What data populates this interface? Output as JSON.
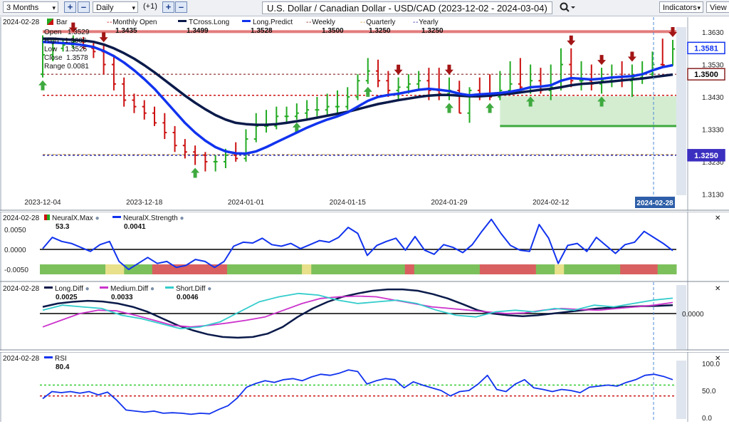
{
  "toolbar": {
    "period": "3 Months",
    "interval": "Daily",
    "offset": "(+1)",
    "title": "U.S. Dollar / Canadian Dollar - USD/CAD (2023-12-02 - 2024-03-04)",
    "indicators_label": "Indicators",
    "view_label": "View"
  },
  "main": {
    "date_label": "2024-02-28",
    "ohlc": {
      "open_label": "Open",
      "open": "1.3529",
      "high_label": "High",
      "high": "1.3606",
      "low_label": "Low",
      "low": "1.3526",
      "close_label": "Close",
      "close": "1.3578",
      "range_label": "Range",
      "range": "0.0081"
    },
    "legend": [
      {
        "label": "Bar",
        "value": ""
      },
      {
        "label": "Monthly Open",
        "value": "1.3435"
      },
      {
        "label": "TCross.Long",
        "value": "1.3499"
      },
      {
        "label": "Long.Predict",
        "value": "1.3528"
      },
      {
        "label": "Weekly",
        "value": "1.3500"
      },
      {
        "label": "Quarterly",
        "value": "1.3250"
      },
      {
        "label": "Yearly",
        "value": "1.3250"
      }
    ],
    "y_ticks": [
      "1.3630",
      "1.3530",
      "1.3430",
      "1.3330",
      "1.3230",
      "1.3130"
    ],
    "price_tags": [
      "1.3581",
      "1.3500",
      "1.3250"
    ],
    "x_ticks": [
      "2023-12-04",
      "2023-12-18",
      "2024-01-01",
      "2024-01-15",
      "2024-01-29",
      "2024-02-12",
      "2024-"
    ],
    "cursor_date": "2024-02-28"
  },
  "panel2": {
    "date_label": "2024-02-28",
    "legend": [
      {
        "label": "NeuralX.Max",
        "value": "53.3"
      },
      {
        "label": "NeuralX.Strength",
        "value": "0.0041"
      }
    ],
    "y_ticks": [
      "0.0050",
      "0.0000",
      "-0.0050"
    ]
  },
  "panel3": {
    "date_label": "2024-02-28",
    "legend": [
      {
        "label": "Long.Diff",
        "value": "0.0025"
      },
      {
        "label": "Medium.Diff",
        "value": "0.0033"
      },
      {
        "label": "Short.Diff",
        "value": "0.0046"
      }
    ],
    "y_ticks": [
      "0.0000"
    ]
  },
  "panel4": {
    "date_label": "2024-02-28",
    "legend": [
      {
        "label": "RSI",
        "value": "80.4"
      }
    ],
    "y_ticks": [
      "100.0",
      "50.0",
      "0.0"
    ]
  },
  "colors": {
    "up": "#22aa22",
    "down": "#cc1111",
    "long_predict": "#1133ee",
    "tcross": "#0a1a4a",
    "monthly": "#cc1111",
    "weekly": "#882222",
    "quarterly": "#d4a24a",
    "yearly": "#2a2aa8",
    "rsi": "#1133ee",
    "medium_diff": "#cc33cc",
    "short_diff": "#33cccc"
  },
  "chart_data": [
    {
      "type": "bar",
      "title": "U.S. Dollar / Canadian Dollar - USD/CAD",
      "ylim": [
        1.31,
        1.365
      ],
      "x": [
        "2023-12-04",
        "2023-12-05",
        "2023-12-06",
        "2023-12-07",
        "2023-12-08",
        "2023-12-11",
        "2023-12-12",
        "2023-12-13",
        "2023-12-14",
        "2023-12-15",
        "2023-12-18",
        "2023-12-19",
        "2023-12-20",
        "2023-12-21",
        "2023-12-22",
        "2023-12-25",
        "2023-12-26",
        "2023-12-27",
        "2023-12-28",
        "2023-12-29",
        "2024-01-01",
        "2024-01-02",
        "2024-01-03",
        "2024-01-04",
        "2024-01-05",
        "2024-01-08",
        "2024-01-09",
        "2024-01-10",
        "2024-01-11",
        "2024-01-12",
        "2024-01-15",
        "2024-01-16",
        "2024-01-17",
        "2024-01-18",
        "2024-01-19",
        "2024-01-22",
        "2024-01-23",
        "2024-01-24",
        "2024-01-25",
        "2024-01-26",
        "2024-01-29",
        "2024-01-30",
        "2024-01-31",
        "2024-02-01",
        "2024-02-02",
        "2024-02-05",
        "2024-02-06",
        "2024-02-07",
        "2024-02-08",
        "2024-02-09",
        "2024-02-12",
        "2024-02-13",
        "2024-02-14",
        "2024-02-15",
        "2024-02-16",
        "2024-02-19",
        "2024-02-20",
        "2024-02-21",
        "2024-02-22",
        "2024-02-23",
        "2024-02-26",
        "2024-02-27",
        "2024-02-28"
      ],
      "open": [
        1.35,
        1.356,
        1.358,
        1.359,
        1.36,
        1.358,
        1.357,
        1.353,
        1.347,
        1.342,
        1.34,
        1.338,
        1.335,
        1.332,
        1.328,
        1.326,
        1.325,
        1.323,
        1.323,
        1.325,
        1.324,
        1.33,
        1.334,
        1.334,
        1.337,
        1.337,
        1.338,
        1.339,
        1.339,
        1.34,
        1.34,
        1.343,
        1.348,
        1.351,
        1.348,
        1.345,
        1.346,
        1.347,
        1.348,
        1.345,
        1.344,
        1.345,
        1.338,
        1.345,
        1.344,
        1.343,
        1.345,
        1.347,
        1.346,
        1.348,
        1.345,
        1.346,
        1.353,
        1.348,
        1.348,
        1.347,
        1.348,
        1.349,
        1.348,
        1.349,
        1.35,
        1.353,
        1.3529
      ],
      "high": [
        1.362,
        1.3605,
        1.361,
        1.362,
        1.3615,
        1.36,
        1.359,
        1.356,
        1.349,
        1.344,
        1.342,
        1.34,
        1.338,
        1.334,
        1.33,
        1.328,
        1.326,
        1.325,
        1.327,
        1.329,
        1.333,
        1.338,
        1.339,
        1.34,
        1.34,
        1.341,
        1.342,
        1.343,
        1.344,
        1.345,
        1.346,
        1.35,
        1.355,
        1.3545,
        1.351,
        1.349,
        1.35,
        1.351,
        1.352,
        1.352,
        1.349,
        1.348,
        1.346,
        1.349,
        1.35,
        1.351,
        1.354,
        1.355,
        1.353,
        1.352,
        1.353,
        1.358,
        1.358,
        1.354,
        1.353,
        1.352,
        1.353,
        1.354,
        1.353,
        1.354,
        1.357,
        1.361,
        1.3606
      ],
      "low": [
        1.349,
        1.354,
        1.357,
        1.358,
        1.358,
        1.355,
        1.35,
        1.345,
        1.34,
        1.338,
        1.336,
        1.334,
        1.33,
        1.326,
        1.324,
        1.322,
        1.32,
        1.32,
        1.321,
        1.323,
        1.323,
        1.329,
        1.332,
        1.333,
        1.335,
        1.336,
        1.336,
        1.337,
        1.337,
        1.338,
        1.339,
        1.342,
        1.347,
        1.346,
        1.343,
        1.342,
        1.344,
        1.345,
        1.342,
        1.342,
        1.342,
        1.338,
        1.335,
        1.342,
        1.342,
        1.342,
        1.344,
        1.345,
        1.344,
        1.344,
        1.342,
        1.345,
        1.346,
        1.345,
        1.345,
        1.344,
        1.346,
        1.346,
        1.343,
        1.347,
        1.349,
        1.352,
        1.3526
      ],
      "close": [
        1.356,
        1.358,
        1.359,
        1.36,
        1.358,
        1.357,
        1.353,
        1.347,
        1.342,
        1.34,
        1.338,
        1.335,
        1.332,
        1.328,
        1.326,
        1.325,
        1.323,
        1.323,
        1.325,
        1.324,
        1.33,
        1.334,
        1.334,
        1.337,
        1.337,
        1.338,
        1.339,
        1.339,
        1.34,
        1.34,
        1.343,
        1.348,
        1.351,
        1.348,
        1.345,
        1.346,
        1.347,
        1.348,
        1.345,
        1.344,
        1.345,
        1.338,
        1.345,
        1.344,
        1.343,
        1.345,
        1.347,
        1.346,
        1.348,
        1.345,
        1.346,
        1.353,
        1.348,
        1.348,
        1.347,
        1.348,
        1.349,
        1.348,
        1.349,
        1.35,
        1.353,
        1.3529,
        1.3578
      ],
      "series": [
        {
          "name": "Long.Predict",
          "values": [
            1.36,
            1.3598,
            1.3596,
            1.3594,
            1.359,
            1.3584,
            1.3572,
            1.3556,
            1.3536,
            1.3512,
            1.3485,
            1.3455,
            1.342,
            1.3385,
            1.335,
            1.332,
            1.3295,
            1.3275,
            1.3262,
            1.3256,
            1.3255,
            1.3262,
            1.3275,
            1.329,
            1.3305,
            1.332,
            1.3335,
            1.3348,
            1.336,
            1.337,
            1.3382,
            1.34,
            1.3418,
            1.343,
            1.3436,
            1.344,
            1.3446,
            1.3452,
            1.3455,
            1.3452,
            1.3448,
            1.344,
            1.3435,
            1.3438,
            1.344,
            1.3442,
            1.3446,
            1.3452,
            1.346,
            1.3462,
            1.3466,
            1.348,
            1.3488,
            1.3486,
            1.3484,
            1.3486,
            1.349,
            1.3492,
            1.3494,
            1.35,
            1.3512,
            1.3522,
            1.3528
          ]
        },
        {
          "name": "TCross.Long",
          "values": [
            1.361,
            1.361,
            1.3608,
            1.3606,
            1.3604,
            1.36,
            1.3592,
            1.358,
            1.3565,
            1.3548,
            1.3528,
            1.3506,
            1.3482,
            1.3458,
            1.3434,
            1.3412,
            1.3392,
            1.3374,
            1.336,
            1.335,
            1.3346,
            1.3344,
            1.3344,
            1.3346,
            1.335,
            1.3355,
            1.336,
            1.3366,
            1.3372,
            1.3378,
            1.3384,
            1.3392,
            1.34,
            1.3408,
            1.3414,
            1.342,
            1.3425,
            1.343,
            1.3434,
            1.3436,
            1.3436,
            1.3434,
            1.3432,
            1.3432,
            1.3434,
            1.3437,
            1.344,
            1.3444,
            1.3448,
            1.3452,
            1.3455,
            1.346,
            1.3466,
            1.347,
            1.3472,
            1.3475,
            1.3478,
            1.3481,
            1.3484,
            1.3487,
            1.3491,
            1.3495,
            1.3499
          ]
        }
      ],
      "levels": [
        {
          "name": "Monthly Open",
          "value": 1.3435
        },
        {
          "name": "Weekly",
          "value": 1.35
        },
        {
          "name": "Quarterly",
          "value": 1.325
        },
        {
          "name": "Yearly",
          "value": 1.325
        }
      ]
    },
    {
      "type": "line",
      "title": "NeuralX.Strength",
      "ylim": [
        -0.008,
        0.008
      ],
      "series": [
        {
          "name": "NeuralX.Strength",
          "values": [
            0.0002,
            0.003,
            0.002,
            0.0015,
            0.0005,
            -0.0005,
            0.0012,
            0.002,
            -0.003,
            -0.005,
            -0.0035,
            -0.002,
            -0.0035,
            -0.003,
            -0.0045,
            -0.004,
            -0.0025,
            -0.003,
            -0.0045,
            -0.003,
            0.0008,
            0.0018,
            0.0016,
            0.0028,
            0.0012,
            0.0008,
            0.0015,
            0.0002,
            0.0012,
            0.0022,
            0.0018,
            0.003,
            0.0055,
            0.004,
            -0.0015,
            0.001,
            0.002,
            0.0028,
            -0.0002,
            0.0032,
            -0.0002,
            -0.0012,
            0.0012,
            0.0005,
            -0.0008,
            0.0012,
            0.0045,
            0.0075,
            0.004,
            0.001,
            -0.0002,
            -0.0005,
            0.0062,
            0.0028,
            -0.0035,
            0.001,
            0.0015,
            -0.0005,
            0.003,
            0.001,
            -0.001,
            0.0012,
            0.0018,
            0.0045,
            0.003,
            0.0015,
            -0.0003
          ]
        }
      ],
      "ribbon": [
        1,
        1,
        1,
        1,
        1,
        1,
        1,
        0,
        0,
        1,
        1,
        1,
        2,
        2,
        2,
        2,
        2,
        2,
        2,
        2,
        1,
        1,
        1,
        1,
        1,
        1,
        1,
        1,
        0,
        1,
        1,
        1,
        1,
        1,
        1,
        1,
        1,
        1,
        1,
        2,
        1,
        1,
        1,
        1,
        1,
        1,
        1,
        2,
        2,
        2,
        2,
        2,
        2,
        1,
        1,
        0,
        1,
        1,
        1,
        1,
        1,
        1,
        2,
        2,
        2,
        2,
        1,
        1
      ]
    },
    {
      "type": "line",
      "title": "Diff",
      "series": [
        {
          "name": "Long.Diff",
          "values": [
            0.002,
            0.003,
            0.0035,
            0.0038,
            0.0036,
            0.003,
            0.002,
            0.0005,
            -0.0015,
            -0.0035,
            -0.005,
            -0.0062,
            -0.007,
            -0.0072,
            -0.007,
            -0.006,
            -0.004,
            -0.001,
            0.0015,
            0.0035,
            0.005,
            0.006,
            0.0068,
            0.0072,
            0.0072,
            0.0068,
            0.0058,
            0.0045,
            0.0028,
            0.001,
            0.0,
            -0.0005,
            -0.0008,
            -0.0005,
            0.0,
            0.0005,
            0.001,
            0.0015,
            0.0018,
            0.002,
            0.0022,
            0.0023,
            0.0025
          ]
        },
        {
          "name": "Medium.Diff",
          "values": [
            -0.004,
            -0.002,
            0.0,
            0.001,
            0.0008,
            -0.0005,
            -0.002,
            -0.0035,
            -0.004,
            -0.0035,
            -0.0028,
            -0.002,
            -0.001,
            0.001,
            0.003,
            0.0045,
            0.005,
            0.0052,
            0.005,
            0.004,
            0.003,
            0.002,
            0.0015,
            0.001,
            0.0005,
            0.0,
            0.0002,
            0.001,
            0.0015,
            0.0012,
            0.001,
            0.0015,
            0.002,
            0.0025,
            0.0033
          ]
        },
        {
          "name": "Short.Diff",
          "values": [
            0.001,
            0.0025,
            0.002,
            0.0015,
            -0.0005,
            -0.0015,
            -0.003,
            -0.0045,
            -0.004,
            -0.0025,
            0.0005,
            0.0035,
            0.005,
            0.006,
            0.0055,
            0.004,
            0.003,
            0.0035,
            0.004,
            0.003,
            0.001,
            -0.0005,
            -0.001,
            0.0005,
            0.001,
            0.0005,
            0.0015,
            0.001,
            0.0025,
            0.002,
            0.003,
            0.004,
            0.0046
          ]
        }
      ]
    },
    {
      "type": "line",
      "title": "RSI",
      "ylim": [
        0,
        100
      ],
      "series": [
        {
          "name": "RSI",
          "values": [
            35,
            48,
            46,
            48,
            45,
            48,
            42,
            47,
            32,
            14,
            12,
            10,
            12,
            8,
            9,
            8,
            6,
            8,
            7,
            15,
            22,
            36,
            56,
            63,
            68,
            65,
            70,
            72,
            68,
            75,
            80,
            78,
            82,
            88,
            85,
            62,
            68,
            72,
            70,
            55,
            66,
            60,
            55,
            50,
            40,
            48,
            50,
            62,
            78,
            52,
            48,
            62,
            70,
            55,
            52,
            48,
            52,
            50,
            46,
            56,
            58,
            60,
            58,
            65,
            70,
            78,
            80,
            76,
            70
          ]
        }
      ],
      "levels": [
        {
          "name": "overbought",
          "value": 60
        },
        {
          "name": "oversold",
          "value": 40
        }
      ]
    }
  ]
}
